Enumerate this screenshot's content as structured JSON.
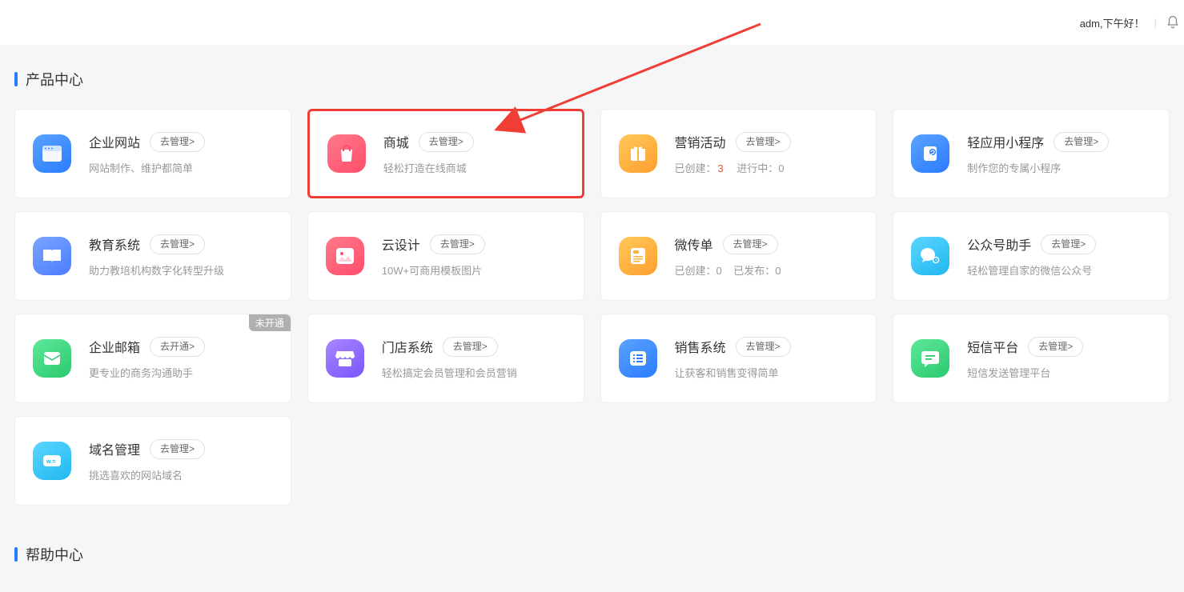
{
  "header": {
    "greeting": "adm,下午好！",
    "separator": "|"
  },
  "section1_title": "产品中心",
  "section2_title": "帮助中心",
  "products": [
    {
      "id": "website",
      "title": "企业网站",
      "action": "去管理>",
      "desc": "网站制作、维护都简单",
      "icon_bg": "#3d8cff"
    },
    {
      "id": "mall",
      "title": "商城",
      "action": "去管理>",
      "desc": "轻松打造在线商城",
      "icon_bg": "#ff5a6e",
      "highlight": true
    },
    {
      "id": "marketing",
      "title": "营销活动",
      "action": "去管理>",
      "desc_parts": {
        "created_label": "已创建：",
        "created_value": "3",
        "running_label": "进行中：",
        "running_value": "0"
      },
      "icon_bg": "#ffb13d"
    },
    {
      "id": "miniapp",
      "title": "轻应用小程序",
      "action": "去管理>",
      "desc": "制作您的专属小程序",
      "icon_bg": "#3d8cff"
    },
    {
      "id": "education",
      "title": "教育系统",
      "action": "去管理>",
      "desc": "助力教培机构数字化转型升级",
      "icon_bg": "#5b8dff"
    },
    {
      "id": "design",
      "title": "云设计",
      "action": "去管理>",
      "desc": "10W+可商用模板图片",
      "icon_bg": "#ff4d6b"
    },
    {
      "id": "flyer",
      "title": "微传单",
      "action": "去管理>",
      "desc_parts": {
        "created_label": "已创建：",
        "created_value2": "0",
        "published_label": "已发布：",
        "published_value": "0"
      },
      "icon_bg": "#ffb13d"
    },
    {
      "id": "wechat",
      "title": "公众号助手",
      "action": "去管理>",
      "desc": "轻松管理自家的微信公众号",
      "icon_bg": "#35c5ff"
    },
    {
      "id": "email",
      "title": "企业邮箱",
      "action": "去开通>",
      "desc": "更专业的商务沟通助手",
      "icon_bg": "#3dd47a",
      "tag": "未开通"
    },
    {
      "id": "store",
      "title": "门店系统",
      "action": "去管理>",
      "desc": "轻松搞定会员管理和会员营销",
      "icon_bg": "#8a5eff"
    },
    {
      "id": "sales",
      "title": "销售系统",
      "action": "去管理>",
      "desc": "让获客和销售变得简单",
      "icon_bg": "#3d8cff"
    },
    {
      "id": "sms",
      "title": "短信平台",
      "action": "去管理>",
      "desc": "短信发送管理平台",
      "icon_bg": "#3dd47a"
    },
    {
      "id": "domain",
      "title": "域名管理",
      "action": "去管理>",
      "desc": "挑选喜欢的网站域名",
      "icon_bg": "#35c5ff"
    }
  ]
}
